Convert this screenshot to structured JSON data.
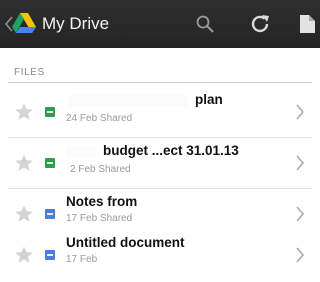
{
  "app": {
    "title": "My Drive"
  },
  "toolbar": {
    "icons": [
      "search-icon",
      "refresh-icon",
      "document-icon"
    ]
  },
  "section": {
    "label": "FILES"
  },
  "files": [
    {
      "name": "plan",
      "date": "24 Feb",
      "shared": "Shared",
      "type": "sheet",
      "starred": false
    },
    {
      "name": "budget ...ect 31.01.13",
      "date": "2 Feb",
      "shared": "Shared",
      "type": "sheet",
      "starred": false
    },
    {
      "name": "Notes from",
      "date": "17 Feb",
      "shared": "Shared",
      "type": "doc",
      "starred": false
    },
    {
      "name": "Untitled document",
      "date": "17 Feb",
      "shared": "",
      "type": "doc",
      "starred": false
    }
  ],
  "colors": {
    "topbar": "#2a2a2a",
    "sheet": "#2e9e4d",
    "doc": "#4a7fd6",
    "divider": "#c9c9c9",
    "meta_text": "#9a9a9a"
  }
}
